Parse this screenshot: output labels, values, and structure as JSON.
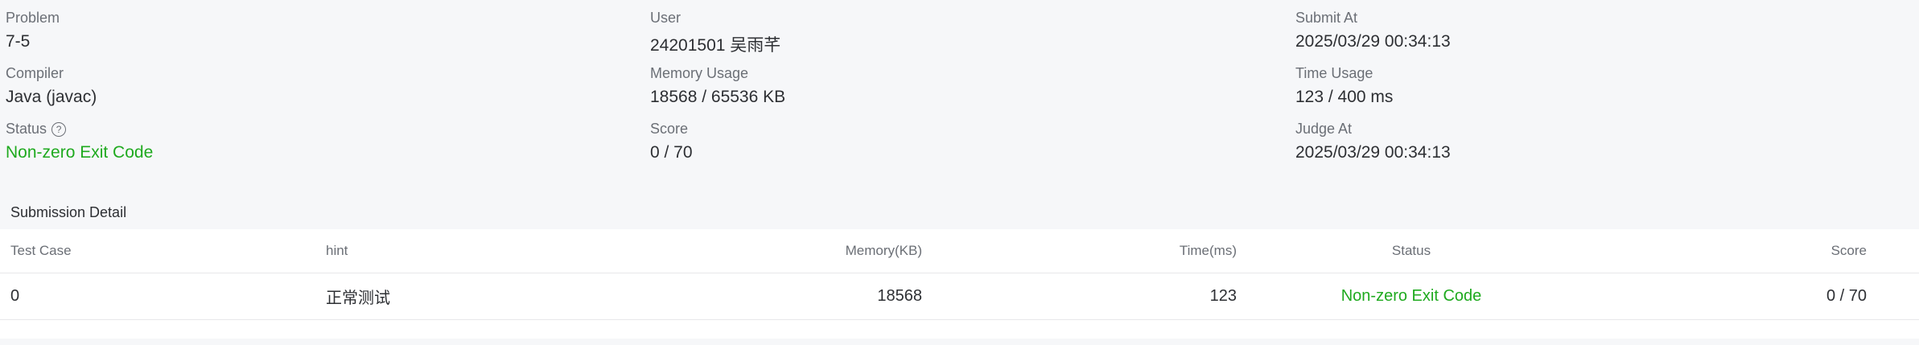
{
  "info": {
    "col1": [
      {
        "label": "Problem",
        "value": "7-5"
      },
      {
        "label": "Compiler",
        "value": "Java (javac)"
      },
      {
        "label": "Status",
        "value": "Non-zero Exit Code",
        "help_icon": "question-circle-icon"
      }
    ],
    "col2": [
      {
        "label": "User",
        "value": "24201501 吴雨芊"
      },
      {
        "label": "Memory Usage",
        "value": "18568 / 65536 KB"
      },
      {
        "label": "Score",
        "value": "0 / 70"
      }
    ],
    "col3": [
      {
        "label": "Submit At",
        "value": "2025/03/29 00:34:13"
      },
      {
        "label": "Time Usage",
        "value": "123 / 400 ms"
      },
      {
        "label": "Judge At",
        "value": "2025/03/29 00:34:13"
      }
    ]
  },
  "detail": {
    "title": "Submission Detail",
    "columns": {
      "test_case": "Test Case",
      "hint": "hint",
      "memory": "Memory(KB)",
      "time": "Time(ms)",
      "status": "Status",
      "score": "Score"
    },
    "rows": [
      {
        "test_case": "0",
        "hint": "正常测试",
        "memory": "18568",
        "time": "123",
        "status": "Non-zero Exit Code",
        "score": "0 / 70"
      }
    ]
  },
  "colors": {
    "success": "#1faa1f",
    "label": "#6b6f76",
    "text": "#2d2f33",
    "panel_bg": "#f6f7f9"
  }
}
